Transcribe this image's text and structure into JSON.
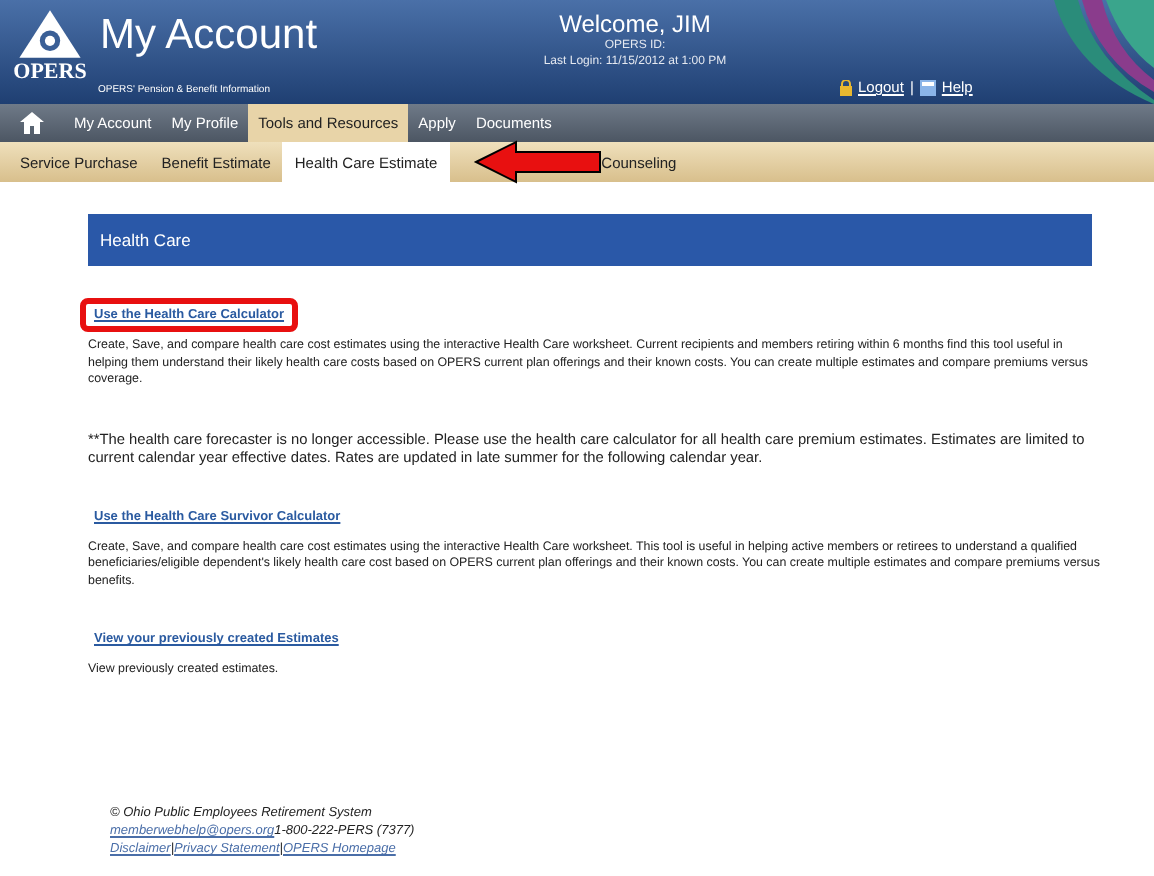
{
  "header": {
    "title": "My Account",
    "logo_text": "OPERS",
    "subtitle": "OPERS' Pension & Benefit Information",
    "welcome": "Welcome,  JIM",
    "id_label": "OPERS ID:",
    "last_login": "Last Login: 11/15/2012 at 1:00 PM",
    "logout": "Logout",
    "separator": "|",
    "help": "Help"
  },
  "nav": [
    {
      "label": "My Account",
      "selected": false
    },
    {
      "label": "My Profile",
      "selected": false
    },
    {
      "label": "Tools and Resources",
      "selected": true
    },
    {
      "label": "Apply",
      "selected": false
    },
    {
      "label": "Documents",
      "selected": false
    }
  ],
  "subnav": [
    {
      "label": "Service Purchase",
      "selected": false
    },
    {
      "label": "Benefit Estimate",
      "selected": false
    },
    {
      "label": "Health Care Estimate",
      "selected": true
    },
    {
      "label": "Counseling",
      "selected": false
    }
  ],
  "section_title": "Health Care",
  "blocks": [
    {
      "kind": "link",
      "text": "Use the Health Care Calculator",
      "highlighted": true
    },
    {
      "kind": "text",
      "text": "Create, Save, and compare health care cost estimates using the interactive Health Care worksheet. Current recipients and members retiring within 6 months find this tool useful in helping them understand their likely health care costs based on OPERS current plan offerings and their known costs. You can create multiple estimates and compare premiums versus coverage."
    },
    {
      "kind": "notice",
      "text": "**The health care forecaster is no longer accessible. Please use the health care calculator for all health care premium estimates. Estimates are limited to current calendar year effective dates. Rates are updated in late summer for the following calendar year."
    },
    {
      "kind": "link",
      "text": "Use the Health Care Survivor Calculator",
      "highlighted": false
    },
    {
      "kind": "text",
      "text": "Create, Save, and compare health care cost estimates using the interactive Health Care worksheet. This tool is useful in helping active members or retirees to understand a qualified beneficiaries/eligible dependent's likely health care cost based on OPERS current plan offerings and their known costs. You can create multiple estimates and compare premiums versus benefits."
    },
    {
      "kind": "link",
      "text": "View your previously created Estimates",
      "highlighted": false
    },
    {
      "kind": "text",
      "text": "View previously created estimates."
    }
  ],
  "footer": {
    "copyright": "© Ohio Public Employees Retirement System",
    "email": "memberwebhelp@opers.org",
    "phone": "1-800-222-PERS (7377)",
    "links": [
      {
        "kind": "link",
        "text": "Disclaimer"
      },
      {
        "kind": "sep",
        "text": "|"
      },
      {
        "kind": "link",
        "text": "Privacy Statement"
      },
      {
        "kind": "sep",
        "text": "|"
      },
      {
        "kind": "link",
        "text": "OPERS Homepage"
      }
    ]
  }
}
